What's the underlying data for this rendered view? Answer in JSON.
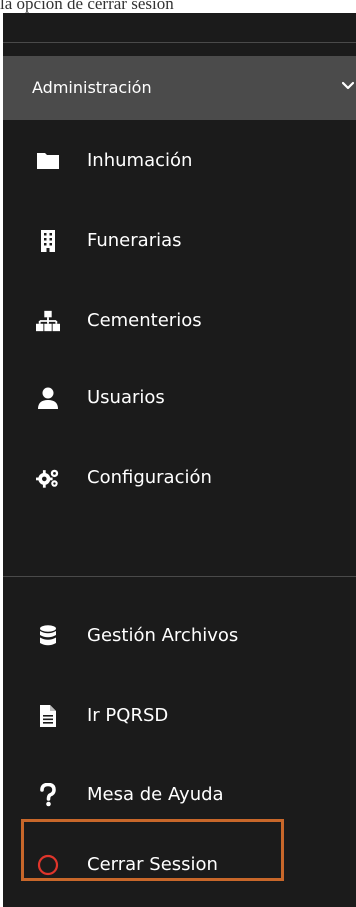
{
  "top_caption": "la opción de cerrar sesión",
  "section": {
    "label": "Administración",
    "chevron_icon": "chevron-down-icon"
  },
  "admin_items": [
    {
      "label": "Inhumación",
      "icon": "folder-icon"
    },
    {
      "label": "Funerarias",
      "icon": "building-icon"
    },
    {
      "label": "Cementerios",
      "icon": "sitemap-icon"
    },
    {
      "label": "Usuarios",
      "icon": "user-icon"
    },
    {
      "label": "Configuración",
      "icon": "cogs-icon"
    }
  ],
  "bottom_items": [
    {
      "label": "Gestión Archivos",
      "icon": "database-icon"
    },
    {
      "label": "Ir PQRSD",
      "icon": "document-icon"
    },
    {
      "label": "Mesa de Ayuda",
      "icon": "question-icon"
    },
    {
      "label": "Cerrar Session",
      "icon": "circle-icon"
    }
  ],
  "colors": {
    "sidebar_bg": "#1b1b1b",
    "header_bg": "#4b4b4b",
    "text": "#ffffff",
    "logout_icon": "#e0352b",
    "highlight_border": "#c8672a"
  }
}
